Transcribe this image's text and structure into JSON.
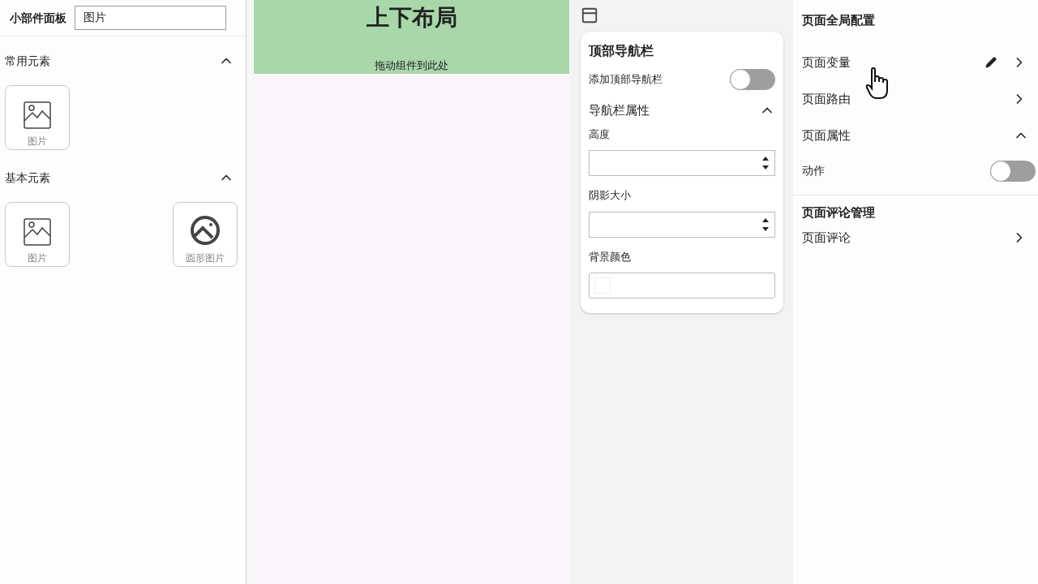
{
  "widget_panel": {
    "title": "小部件面板",
    "search": {
      "value": "图片"
    },
    "sections": [
      {
        "title": "常用元素",
        "expanded": true,
        "items": [
          {
            "label": "图片",
            "kind": "image"
          }
        ]
      },
      {
        "title": "基本元素",
        "expanded": true,
        "items": [
          {
            "label": "图片",
            "kind": "image"
          },
          {
            "label": "圆形图片",
            "kind": "circle_image"
          }
        ]
      }
    ]
  },
  "canvas": {
    "title": "上下布局",
    "hint": "拖动组件到此处"
  },
  "nav_props": {
    "title": "顶部导航栏",
    "toggle": {
      "label": "添加顶部导航栏",
      "on": false
    },
    "section": {
      "title": "导航栏属性",
      "expanded": true,
      "fields": [
        {
          "label": "高度",
          "kind": "number"
        },
        {
          "label": "阴影大小",
          "kind": "number"
        },
        {
          "label": "背景颜色",
          "kind": "color"
        }
      ]
    }
  },
  "global_config": {
    "title": "页面全局配置",
    "items": [
      {
        "label": "页面变量",
        "editable": true
      },
      {
        "label": "页面路由",
        "editable": false
      }
    ],
    "section": {
      "title": "页面属性",
      "expanded": true,
      "toggles": [
        {
          "label": "动作",
          "on": false
        }
      ]
    },
    "comments": {
      "title": "页面评论管理",
      "items": [
        {
          "label": "页面评论"
        }
      ]
    }
  }
}
